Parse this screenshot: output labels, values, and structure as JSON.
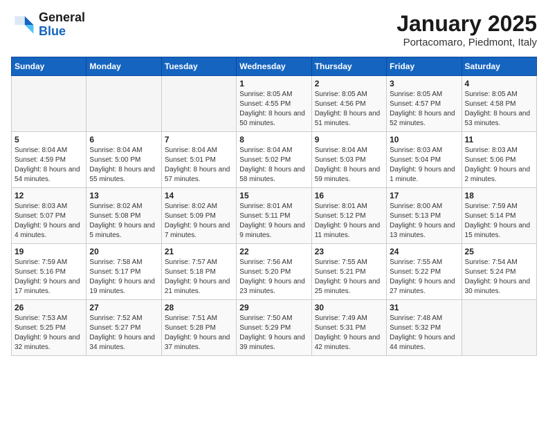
{
  "header": {
    "logo_general": "General",
    "logo_blue": "Blue",
    "month": "January 2025",
    "location": "Portacomaro, Piedmont, Italy"
  },
  "weekdays": [
    "Sunday",
    "Monday",
    "Tuesday",
    "Wednesday",
    "Thursday",
    "Friday",
    "Saturday"
  ],
  "weeks": [
    [
      {
        "day": "",
        "info": ""
      },
      {
        "day": "",
        "info": ""
      },
      {
        "day": "",
        "info": ""
      },
      {
        "day": "1",
        "info": "Sunrise: 8:05 AM\nSunset: 4:55 PM\nDaylight: 8 hours\nand 50 minutes."
      },
      {
        "day": "2",
        "info": "Sunrise: 8:05 AM\nSunset: 4:56 PM\nDaylight: 8 hours\nand 51 minutes."
      },
      {
        "day": "3",
        "info": "Sunrise: 8:05 AM\nSunset: 4:57 PM\nDaylight: 8 hours\nand 52 minutes."
      },
      {
        "day": "4",
        "info": "Sunrise: 8:05 AM\nSunset: 4:58 PM\nDaylight: 8 hours\nand 53 minutes."
      }
    ],
    [
      {
        "day": "5",
        "info": "Sunrise: 8:04 AM\nSunset: 4:59 PM\nDaylight: 8 hours\nand 54 minutes."
      },
      {
        "day": "6",
        "info": "Sunrise: 8:04 AM\nSunset: 5:00 PM\nDaylight: 8 hours\nand 55 minutes."
      },
      {
        "day": "7",
        "info": "Sunrise: 8:04 AM\nSunset: 5:01 PM\nDaylight: 8 hours\nand 57 minutes."
      },
      {
        "day": "8",
        "info": "Sunrise: 8:04 AM\nSunset: 5:02 PM\nDaylight: 8 hours\nand 58 minutes."
      },
      {
        "day": "9",
        "info": "Sunrise: 8:04 AM\nSunset: 5:03 PM\nDaylight: 8 hours\nand 59 minutes."
      },
      {
        "day": "10",
        "info": "Sunrise: 8:03 AM\nSunset: 5:04 PM\nDaylight: 9 hours\nand 1 minute."
      },
      {
        "day": "11",
        "info": "Sunrise: 8:03 AM\nSunset: 5:06 PM\nDaylight: 9 hours\nand 2 minutes."
      }
    ],
    [
      {
        "day": "12",
        "info": "Sunrise: 8:03 AM\nSunset: 5:07 PM\nDaylight: 9 hours\nand 4 minutes."
      },
      {
        "day": "13",
        "info": "Sunrise: 8:02 AM\nSunset: 5:08 PM\nDaylight: 9 hours\nand 5 minutes."
      },
      {
        "day": "14",
        "info": "Sunrise: 8:02 AM\nSunset: 5:09 PM\nDaylight: 9 hours\nand 7 minutes."
      },
      {
        "day": "15",
        "info": "Sunrise: 8:01 AM\nSunset: 5:11 PM\nDaylight: 9 hours\nand 9 minutes."
      },
      {
        "day": "16",
        "info": "Sunrise: 8:01 AM\nSunset: 5:12 PM\nDaylight: 9 hours\nand 11 minutes."
      },
      {
        "day": "17",
        "info": "Sunrise: 8:00 AM\nSunset: 5:13 PM\nDaylight: 9 hours\nand 13 minutes."
      },
      {
        "day": "18",
        "info": "Sunrise: 7:59 AM\nSunset: 5:14 PM\nDaylight: 9 hours\nand 15 minutes."
      }
    ],
    [
      {
        "day": "19",
        "info": "Sunrise: 7:59 AM\nSunset: 5:16 PM\nDaylight: 9 hours\nand 17 minutes."
      },
      {
        "day": "20",
        "info": "Sunrise: 7:58 AM\nSunset: 5:17 PM\nDaylight: 9 hours\nand 19 minutes."
      },
      {
        "day": "21",
        "info": "Sunrise: 7:57 AM\nSunset: 5:18 PM\nDaylight: 9 hours\nand 21 minutes."
      },
      {
        "day": "22",
        "info": "Sunrise: 7:56 AM\nSunset: 5:20 PM\nDaylight: 9 hours\nand 23 minutes."
      },
      {
        "day": "23",
        "info": "Sunrise: 7:55 AM\nSunset: 5:21 PM\nDaylight: 9 hours\nand 25 minutes."
      },
      {
        "day": "24",
        "info": "Sunrise: 7:55 AM\nSunset: 5:22 PM\nDaylight: 9 hours\nand 27 minutes."
      },
      {
        "day": "25",
        "info": "Sunrise: 7:54 AM\nSunset: 5:24 PM\nDaylight: 9 hours\nand 30 minutes."
      }
    ],
    [
      {
        "day": "26",
        "info": "Sunrise: 7:53 AM\nSunset: 5:25 PM\nDaylight: 9 hours\nand 32 minutes."
      },
      {
        "day": "27",
        "info": "Sunrise: 7:52 AM\nSunset: 5:27 PM\nDaylight: 9 hours\nand 34 minutes."
      },
      {
        "day": "28",
        "info": "Sunrise: 7:51 AM\nSunset: 5:28 PM\nDaylight: 9 hours\nand 37 minutes."
      },
      {
        "day": "29",
        "info": "Sunrise: 7:50 AM\nSunset: 5:29 PM\nDaylight: 9 hours\nand 39 minutes."
      },
      {
        "day": "30",
        "info": "Sunrise: 7:49 AM\nSunset: 5:31 PM\nDaylight: 9 hours\nand 42 minutes."
      },
      {
        "day": "31",
        "info": "Sunrise: 7:48 AM\nSunset: 5:32 PM\nDaylight: 9 hours\nand 44 minutes."
      },
      {
        "day": "",
        "info": ""
      }
    ]
  ]
}
